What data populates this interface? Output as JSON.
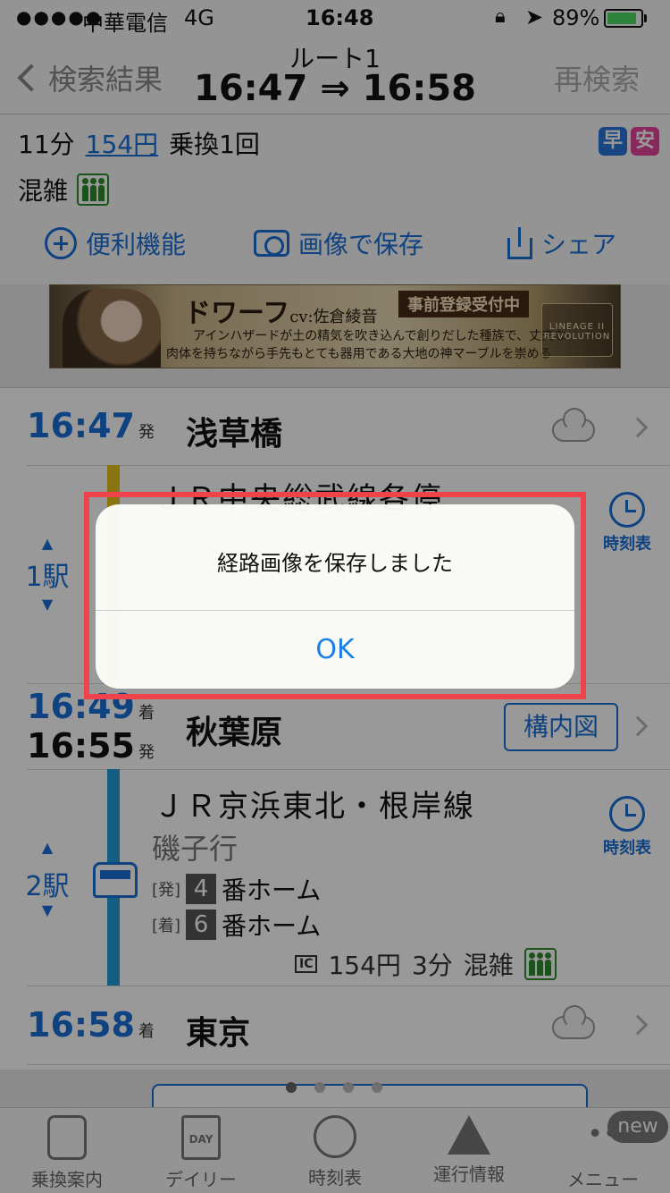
{
  "status_bar": {
    "signal": "●●●●●",
    "carrier": "中華電信",
    "network": "4G",
    "time": "16:48",
    "battery": "89%",
    "battery_level": 0.89
  },
  "nav": {
    "back_label": "検索結果",
    "title": "ルート1",
    "times": "16:47 ⇒ 16:58",
    "research_label": "再検索"
  },
  "summary": {
    "duration": "11分",
    "fare": "154円",
    "transfers": "乗換1回",
    "badge_fast": "早",
    "badge_cheap": "安",
    "crowd_label": "混雑",
    "actions": {
      "tools": "便利機能",
      "save_image": "画像で保存",
      "share": "シェア"
    }
  },
  "ad": {
    "headline": "ドワーフ",
    "cv": "cv:佐倉綾音",
    "preregist": "事前登録受付中",
    "desc_line1": "アインハザードが土の精気を吹き込んで創りだした種族で、丈夫な",
    "desc_line2": "肉体を持ちながら手先もとても器用である大地の神マーブルを崇める",
    "logo": "LINEAGE II REVOLUTION"
  },
  "route": {
    "stop1": {
      "time": "16:47",
      "suffix": "発",
      "name": "浅草橋"
    },
    "leg1": {
      "stops": "1駅",
      "line_name": "ＪＲ中央総武線各停",
      "timetable": "時刻表"
    },
    "stop2": {
      "arrive": "16:49",
      "arrive_suffix": "着",
      "depart": "16:55",
      "depart_suffix": "発",
      "name": "秋葉原",
      "map_button": "構内図"
    },
    "leg2": {
      "stops": "2駅",
      "line_name": "ＪＲ京浜東北・根岸線",
      "destination": "磯子行",
      "dep_tag": "[発]",
      "dep_platform": "4",
      "arr_tag": "[着]",
      "arr_platform": "6",
      "platform_suffix": "番ホーム",
      "ic": "IC",
      "fare": "154円",
      "duration": "3分",
      "crowd": "混雑",
      "timetable": "時刻表"
    },
    "stop3": {
      "time": "16:58",
      "suffix": "着",
      "name": "東京"
    }
  },
  "tabs": {
    "transfer": "乗換案内",
    "daily": "デイリー",
    "day_icon_text": "DAY",
    "timetable": "時刻表",
    "service_info": "運行情報",
    "menu": "メニュー",
    "menu_icon": "••",
    "new_badge": "new"
  },
  "alert": {
    "message": "経路画像を保存しました",
    "ok": "OK"
  },
  "colors": {
    "accent": "#1a6fd6",
    "highlight": "#f0424a",
    "chuo_line": "#e6c21a",
    "keihin_line": "#1e9bd7"
  }
}
